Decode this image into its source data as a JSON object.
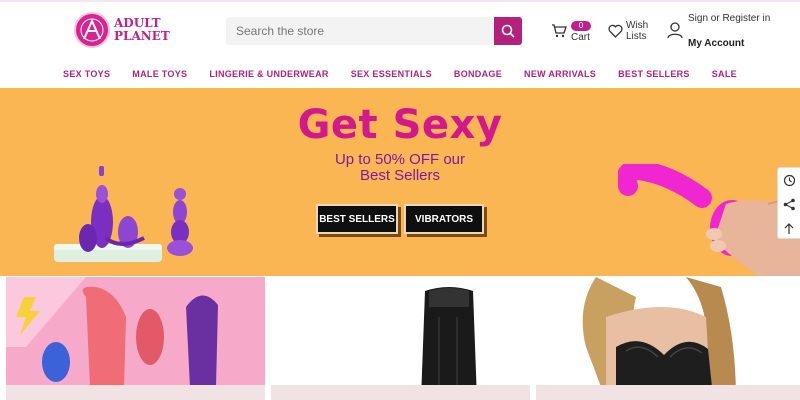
{
  "brand": {
    "line1": "ADULT",
    "line2": "PLANET",
    "accent": "#c0208a"
  },
  "search": {
    "placeholder": "Search the store"
  },
  "cart": {
    "count": "0",
    "label": "Cart"
  },
  "wishlist": {
    "label": "Wish Lists"
  },
  "account": {
    "line1": "Sign or Register in",
    "line2": "My Account"
  },
  "nav": {
    "items": [
      "SEX TOYS",
      "MALE TOYS",
      "LINGERIE & UNDERWEAR",
      "SEX ESSENTIALS",
      "BONDAGE",
      "NEW ARRIVALS",
      "BEST SELLERS",
      "SALE"
    ]
  },
  "hero": {
    "title": "Get Sexy",
    "sub1": "Up to 50% OFF our",
    "sub2": "Best Sellers",
    "btn1": "BEST SELLERS",
    "btn2": "VIBRATORS",
    "bg": "#fbb654"
  },
  "icons": {
    "search": "search-icon",
    "cart": "cart-icon",
    "wish": "heart-icon",
    "account": "user-icon",
    "recent": "history-icon",
    "share": "share-icon",
    "top": "arrow-up-icon"
  }
}
